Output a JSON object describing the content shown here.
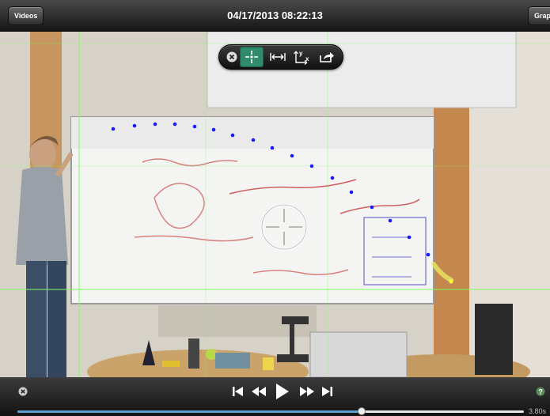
{
  "topbar": {
    "left_button": "Videos",
    "timestamp": "04/17/2013 08:22:13",
    "right_button": "Graph"
  },
  "toolbar": {
    "tools": [
      "close-icon",
      "crosshair-icon",
      "measure-distance-icon",
      "axes-icon",
      "share-icon"
    ],
    "selected_tool": "crosshair-icon"
  },
  "playback": {
    "controls": [
      "skip-to-start-icon",
      "rewind-icon",
      "play-icon",
      "fast-forward-icon",
      "skip-to-end-icon"
    ],
    "progress": 0.68,
    "time_label": "3.80s"
  },
  "colors": {
    "accent": "#2f8a6e",
    "track_point": "#1a1aff",
    "grid_line": "#7dff5a"
  }
}
